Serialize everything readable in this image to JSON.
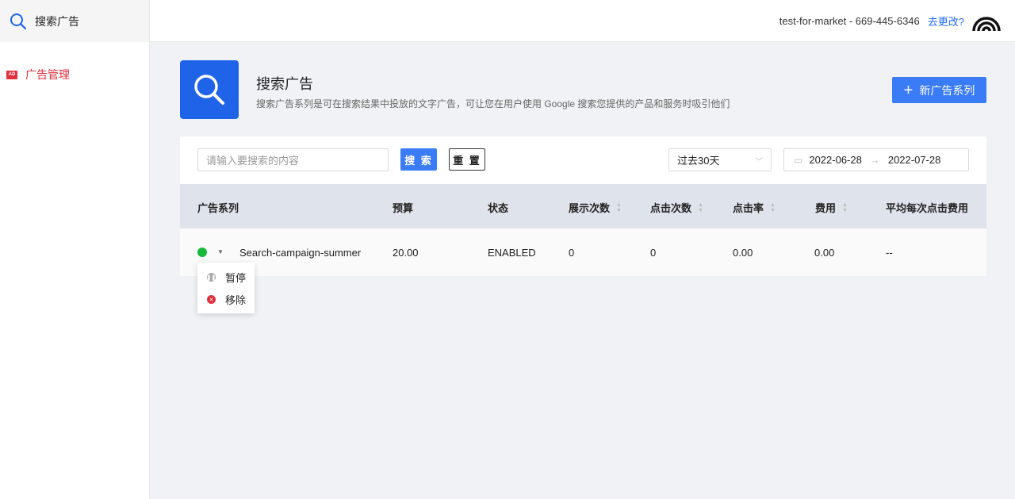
{
  "sidebar": {
    "title": "搜索广告",
    "nav": [
      {
        "badge": "AD",
        "label": "广告管理"
      }
    ]
  },
  "topbar": {
    "account": "test-for-market - 669-445-6346",
    "change_link": "去更改?"
  },
  "header": {
    "title": "搜索广告",
    "description": "搜索广告系列是可在搜索结果中投放的文字广告，可让您在用户使用 Google 搜索您提供的产品和服务时吸引他们",
    "new_button": "新广告系列"
  },
  "filters": {
    "search_placeholder": "请输入要搜索的内容",
    "search_button": "搜 索",
    "reset_button": "重 置",
    "period": "过去30天",
    "date_start": "2022-06-28",
    "date_end": "2022-07-28"
  },
  "table": {
    "columns": [
      "广告系列",
      "预算",
      "状态",
      "展示次数",
      "点击次数",
      "点击率",
      "费用",
      "平均每次点击费用"
    ],
    "rows": [
      {
        "campaign": "Search-campaign-summer",
        "budget": "20.00",
        "status": "ENABLED",
        "impressions": "0",
        "clicks": "0",
        "ctr": "0.00",
        "cost": "0.00",
        "avg_cpc": "--"
      }
    ]
  },
  "status_menu": {
    "items": [
      {
        "label": "暂停",
        "icon": "pause-icon",
        "color": "#aaaaaa"
      },
      {
        "label": "移除",
        "icon": "remove-icon",
        "color": "#e0303c"
      }
    ]
  },
  "colors": {
    "primary": "#3a7bf6",
    "accent_red": "#e0303c",
    "enabled_green": "#18b83a"
  }
}
